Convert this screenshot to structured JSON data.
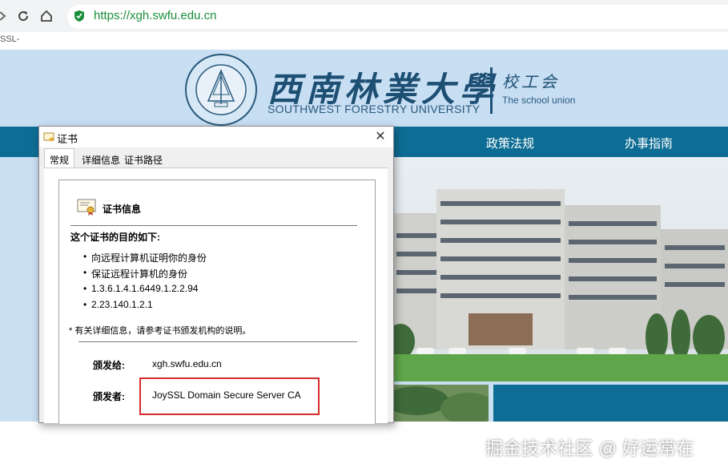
{
  "browser": {
    "url": "https://xgh.swfu.edu.cn",
    "bookmark": "SSL-"
  },
  "site": {
    "university_cn": "西南林業大學",
    "university_en": "SOUTHWEST FORESTRY UNIVERSITY",
    "union_cn": "校工会",
    "union_en": "The school union",
    "nav": [
      "政策法规",
      "办事指南"
    ],
    "watermark": "掘金技术社区 @ 好运常在"
  },
  "dialog": {
    "title": "证书",
    "tabs": [
      "常规",
      "详细信息",
      "证书路径"
    ],
    "info_title": "证书信息",
    "purpose_title": "这个证书的目的如下:",
    "purposes": [
      "向远程计算机证明你的身份",
      "保证远程计算机的身份",
      "1.3.6.1.4.1.6449.1.2.2.94",
      "2.23.140.1.2.1"
    ],
    "note": "* 有关详细信息，请参考证书颁发机构的说明。",
    "issued_to_label": "颁发给:",
    "issued_to": "xgh.swfu.edu.cn",
    "issued_by_label": "颁发者:",
    "issued_by": "JoySSL Domain Secure Server CA"
  },
  "colors": {
    "accent": "#0e6d94",
    "secure_green": "#1a8f3a",
    "highlight_red": "#d62b2b"
  }
}
